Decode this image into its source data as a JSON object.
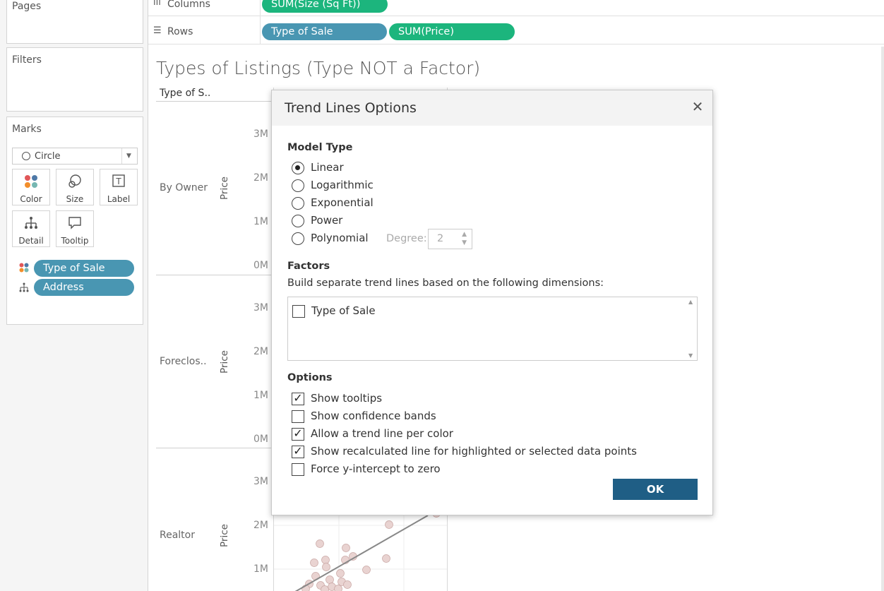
{
  "left_panel": {
    "pages_label": "Pages",
    "filters_label": "Filters",
    "marks_label": "Marks",
    "mark_type": "Circle",
    "mark_buttons": {
      "color": "Color",
      "size": "Size",
      "label": "Label",
      "detail": "Detail",
      "tooltip": "Tooltip"
    },
    "mark_fields": {
      "color_field": "Type of Sale",
      "detail_field": "Address"
    }
  },
  "shelves": {
    "columns_label": "Columns",
    "rows_label": "Rows",
    "columns_pill": "SUM(Size (Sq Ft))",
    "rows_pill_1": "Type of Sale",
    "rows_pill_2": "SUM(Price)"
  },
  "viz": {
    "title": "Types of Listings (Type NOT a Factor)",
    "header_type_of_sale": "Type of S..",
    "rows": [
      {
        "label": "By Owner",
        "axis_label": "Price",
        "ticks": [
          "3M",
          "2M",
          "1M",
          "0M"
        ]
      },
      {
        "label": "Foreclos..",
        "axis_label": "Price",
        "ticks": [
          "3M",
          "2M",
          "1M",
          "0M"
        ]
      },
      {
        "label": "Realtor",
        "axis_label": "Price",
        "ticks": [
          "3M",
          "2M",
          "1M"
        ]
      }
    ]
  },
  "dialog": {
    "title": "Trend Lines Options",
    "model_type_heading": "Model Type",
    "models": [
      {
        "label": "Linear",
        "selected": true
      },
      {
        "label": "Logarithmic",
        "selected": false
      },
      {
        "label": "Exponential",
        "selected": false
      },
      {
        "label": "Power",
        "selected": false
      },
      {
        "label": "Polynomial",
        "selected": false
      }
    ],
    "degree_label": "Degree:",
    "degree_value": "2",
    "factors_heading": "Factors",
    "factors_description": "Build separate trend lines based on the following dimensions:",
    "factor_items": [
      {
        "label": "Type of Sale",
        "checked": false
      }
    ],
    "options_heading": "Options",
    "options": [
      {
        "label": "Show tooltips",
        "checked": true
      },
      {
        "label": "Show confidence bands",
        "checked": false
      },
      {
        "label": "Allow a trend line per color",
        "checked": true
      },
      {
        "label": "Show recalculated line for highlighted or selected data points",
        "checked": true
      },
      {
        "label": "Force y-intercept to zero",
        "checked": false
      }
    ],
    "ok_label": "OK"
  },
  "colors": {
    "pill_dimension": "#4996b2",
    "pill_measure": "#1cb57d",
    "ok_button": "#1f5e85",
    "scatter_point": "#e6cbc8"
  }
}
